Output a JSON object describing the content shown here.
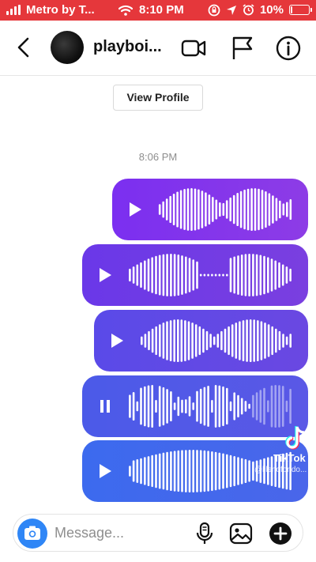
{
  "status_bar": {
    "carrier": "Metro by T...",
    "time": "8:10 PM",
    "battery_percent": "10%",
    "battery_level": 0.1,
    "background_color": "#e5373b"
  },
  "header": {
    "title": "playboi...",
    "icons": [
      "back-chevron-icon",
      "video-call-icon",
      "flag-icon",
      "info-icon"
    ]
  },
  "view_profile_label": "View Profile",
  "timestamp": "8:06 PM",
  "voice_messages": [
    {
      "state": "play",
      "gradient": [
        "#7b2ff0",
        "#8d3ce6"
      ]
    },
    {
      "state": "play",
      "gradient": [
        "#6a38e8",
        "#7a3fe0"
      ]
    },
    {
      "state": "play",
      "gradient": [
        "#5a4ae8",
        "#6a48e2"
      ]
    },
    {
      "state": "pause",
      "gradient": [
        "#4b5ae8",
        "#5a58e6"
      ]
    },
    {
      "state": "play",
      "gradient": [
        "#3c6aee",
        "#4a66ea"
      ]
    }
  ],
  "watermark": {
    "brand": "TikTok",
    "user": "@lilsnofondo..."
  },
  "composer": {
    "placeholder": "Message...",
    "icons": [
      "camera-icon",
      "microphone-icon",
      "gallery-icon",
      "sticker-add-icon"
    ]
  }
}
